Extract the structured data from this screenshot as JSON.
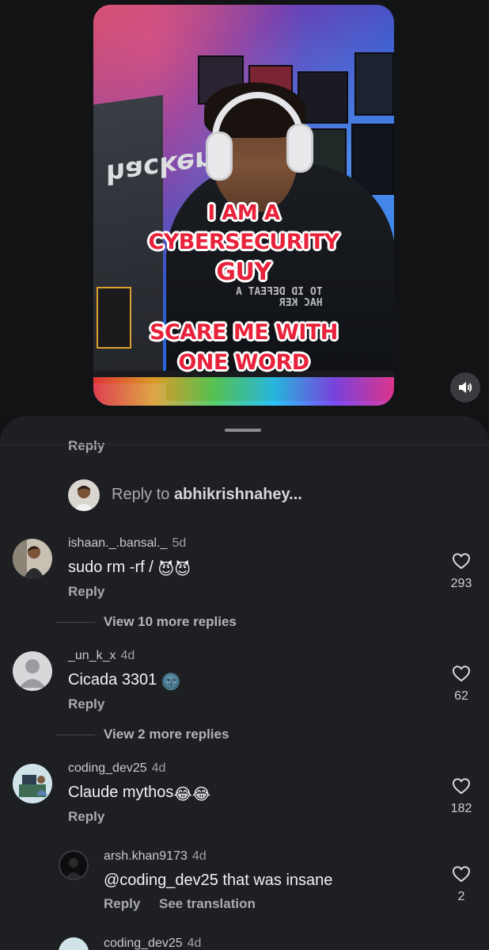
{
  "video": {
    "overlay_lines": [
      "I AM A",
      "CYBERSECURITY",
      "GUY",
      "SCARE ME WITH",
      "ONE WORD"
    ],
    "laptop_sticker_text": "hacker",
    "sound_icon": "speaker-icon"
  },
  "comments_sheet": {
    "cut_off_text": "Reply",
    "reply_input": {
      "prefix": "Reply to ",
      "target": "abhikrishnahey..."
    },
    "comments": [
      {
        "username": "ishaan._.bansal._",
        "age": "5d",
        "text": "sudo rm -rf / ",
        "emoji": "😈😈",
        "reply_label": "Reply",
        "likes": "293",
        "view_more": "View 10 more replies"
      },
      {
        "username": "_un_k_x",
        "age": "4d",
        "text": "Cicada 3301 ",
        "emoji": "🌚",
        "reply_label": "Reply",
        "likes": "62",
        "view_more": "View 2 more replies"
      },
      {
        "username": "coding_dev25",
        "age": "4d",
        "text": "Claude mythos",
        "emoji": "😂😂",
        "reply_label": "Reply",
        "likes": "182"
      }
    ],
    "reply": {
      "username": "arsh.khan9173",
      "age": "4d",
      "text": "@coding_dev25 that was insane",
      "reply_label": "Reply",
      "see_translation": "See translation",
      "likes": "2"
    },
    "cut_off_bottom": {
      "username": "coding_dev25",
      "age": "4d"
    }
  },
  "colors": {
    "background": "#111214",
    "sheet": "#1d1f22",
    "overlay_red": "#e8223a"
  }
}
